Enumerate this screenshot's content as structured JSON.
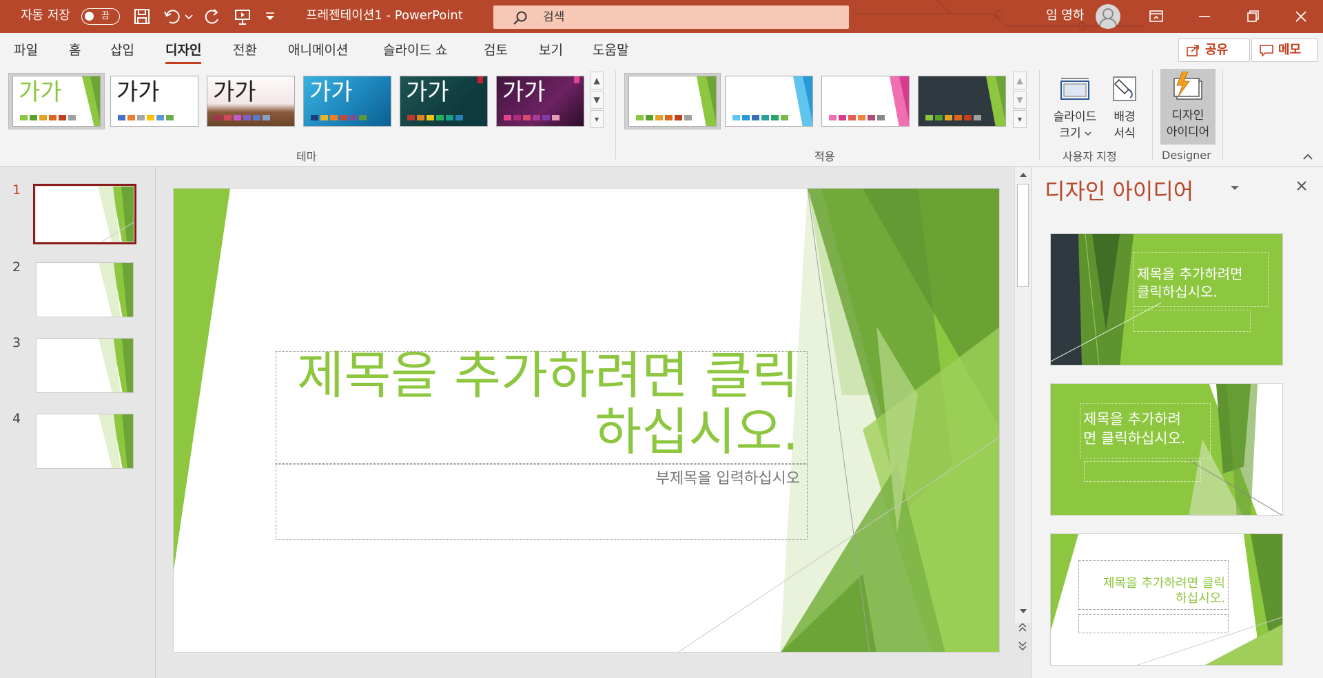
{
  "titlebar": {
    "autosave_label": "자동 저장",
    "autosave_state": "끔",
    "document_title": "프레젠테이션1  -  PowerPoint",
    "search_placeholder": "검색",
    "user_name": "임 영하",
    "color": "#b7472a"
  },
  "tabs": [
    "파일",
    "홈",
    "삽입",
    "디자인",
    "전환",
    "애니메이션",
    "슬라이드 쇼",
    "검토",
    "보기",
    "도움말"
  ],
  "active_tab": "디자인",
  "share_label": "공유",
  "comments_label": "메모",
  "ribbon": {
    "themes_group_label": "테마",
    "theme_glyph": "가가",
    "variants_group_label": "적용",
    "customize_group_label": "사용자 지정",
    "slide_size_label_1": "슬라이드",
    "slide_size_label_2": "크기",
    "format_bg_label_1": "배경",
    "format_bg_label_2": "서식",
    "design_ideas_label_1": "디자인",
    "design_ideas_label_2": "아이디어",
    "designer_group_label": "Designer"
  },
  "thumbnails": [
    "1",
    "2",
    "3",
    "4"
  ],
  "selected_slide": "1",
  "slide": {
    "title_line1": "제목을 추가하려면 클릭",
    "title_line2": "하십시오.",
    "subtitle": "부제목을 입력하십시오"
  },
  "designer_pane": {
    "title": "디자인 아이디어",
    "idea1_title_1": "제목을 추가하려면",
    "idea1_title_2": "클릭하십시오.",
    "idea2_title_1": "제목을 추가하려",
    "idea2_title_2": "면 클릭하십시오.",
    "idea3_title_1": "제목을 추가하려면 클릭",
    "idea3_title_2": "하십시오."
  },
  "colors": {
    "accent": "#c43e1c",
    "green": "#8dc63f",
    "dark_green": "#6da438"
  }
}
